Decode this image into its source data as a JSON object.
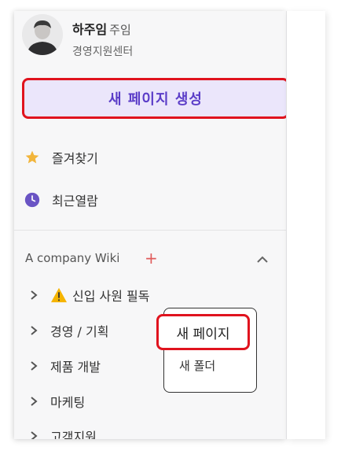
{
  "user": {
    "name": "하주임",
    "title": "주임",
    "department": "경영지원센터"
  },
  "actions": {
    "create_page": "새 페이지 생성"
  },
  "menu": [
    {
      "label": "즐겨찾기",
      "icon": "star-icon",
      "color": "#f2b53b"
    },
    {
      "label": "최근열람",
      "icon": "clock-icon",
      "color": "#6a54c4"
    }
  ],
  "wiki": {
    "title": "A company Wiki",
    "add_symbol": "+",
    "items": [
      {
        "label": "신입 사원 필독",
        "warning": true
      },
      {
        "label": "경영 / 기획"
      },
      {
        "label": "제품 개발"
      },
      {
        "label": "마케팅"
      },
      {
        "label": "고객지원"
      }
    ]
  },
  "context_menu": {
    "new_page": "새 페이지",
    "new_folder": "새 폴더"
  },
  "colors": {
    "accent": "#5b3dc8",
    "highlight": "#e0131e",
    "button_bg": "#ebe6fb"
  }
}
